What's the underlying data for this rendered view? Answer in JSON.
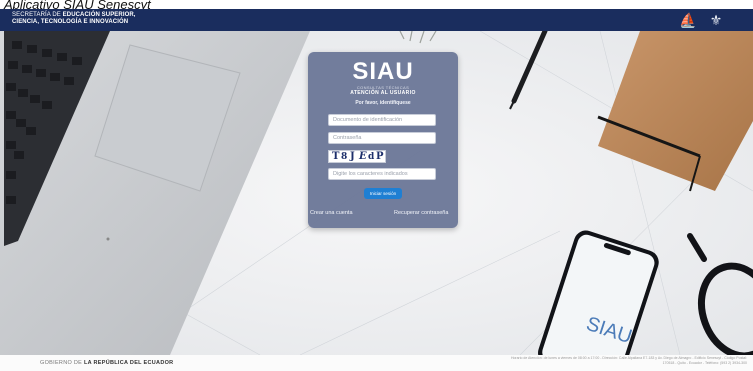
{
  "caption": {
    "text": "Aplicativo SIAU Senescyt"
  },
  "header": {
    "brand_line1_prefix": "SECRETARÍA DE",
    "brand_line1_bold": "EDUCACIÓN SUPERIOR,",
    "brand_line2": "CIENCIA, TECNOLOGÍA E INNOVACIÓN",
    "icons": [
      "ship-emblem-icon",
      "national-coat-of-arms-icon"
    ],
    "background_color": "#1a2d5e"
  },
  "login": {
    "logo": "SIAU",
    "logo_sub1": "CONSULTAS TÉCNICAS",
    "logo_sub2": "ATENCIÓN AL USUARIO",
    "prompt": "Por favor, identifíquese",
    "document_placeholder": "Documento de identificación",
    "password_placeholder": "Contraseña",
    "captcha_text": "T8JEdP",
    "captcha_input_placeholder": "Digite los caracteres indicados",
    "submit_label": "Iniciar sesión",
    "create_account_label": "Crear una cuenta",
    "recover_password_label": "Recuperar contraseña",
    "accent_color": "#1f7fd3"
  },
  "background": {
    "phone_screen_text": "SIAU"
  },
  "footer": {
    "government_prefix": "GOBIERNO DE",
    "government_bold": "LA REPÚBLICA DEL ECUADOR",
    "address": "Horario de Atención: de lunes a viernes de 08:00 a 17:00 - Dirección: Calle Alpallana E7-183 y Av. Diego de Almagro - Edificio Senescyt - Código Postal: 170518 - Quito - Ecuador - Teléfono: (593 2) 3934-300"
  }
}
